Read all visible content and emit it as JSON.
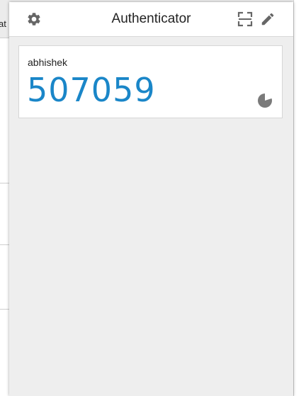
{
  "app": {
    "title": "Authenticator"
  },
  "background": {
    "tab_text_fragment": "at"
  },
  "header": {
    "settings_icon": "gear-icon",
    "scan_icon": "scan-qr-icon",
    "edit_icon": "pencil-icon"
  },
  "entries": [
    {
      "account": "abhishek",
      "code": "507059",
      "timer_icon": "countdown-pie-icon",
      "timer_elapsed_fraction": 0.2
    }
  ],
  "colors": {
    "code": "#1a86c8",
    "icon": "#666666",
    "popup_background": "#eeeeee"
  }
}
